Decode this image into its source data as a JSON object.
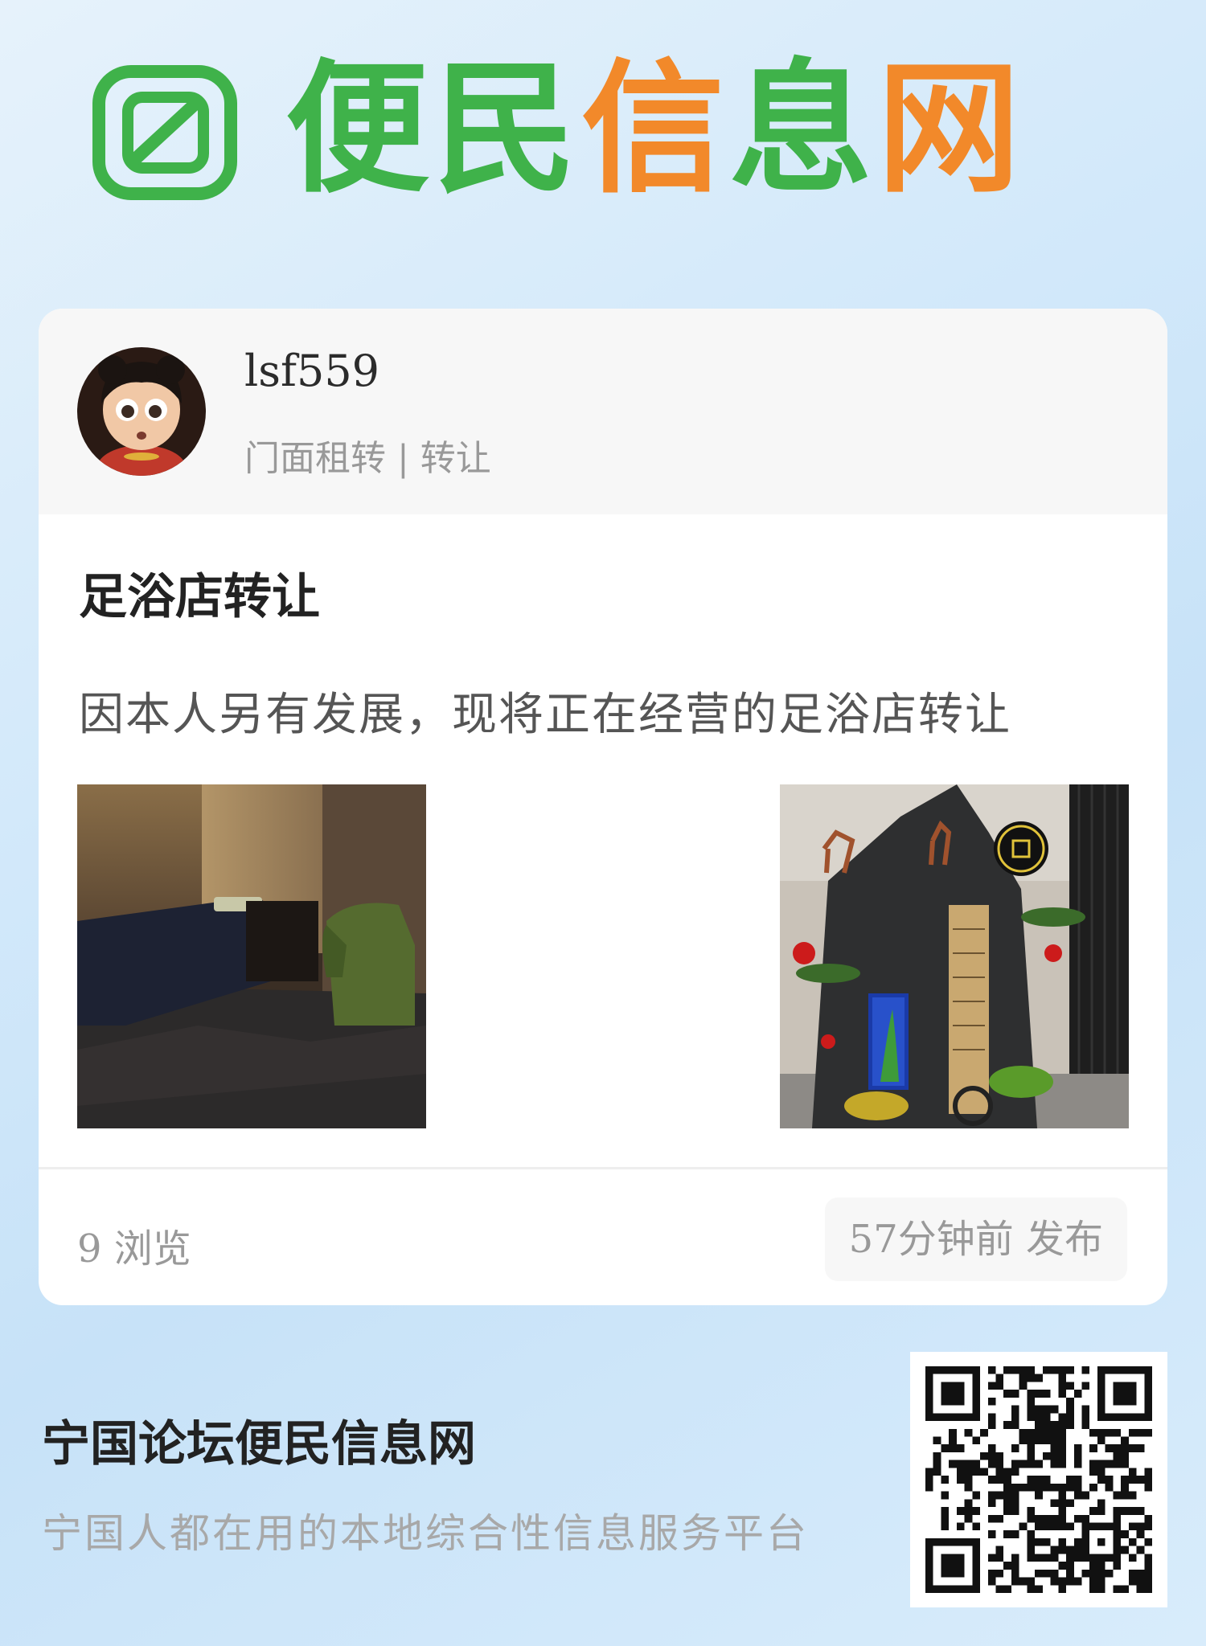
{
  "brand": {
    "logo_text_green_1": "便民",
    "logo_text_orange": "信",
    "logo_text_green_2": "息",
    "logo_text_orange_2": "网",
    "colors": {
      "green": "#3fb24a",
      "orange": "#f2892a"
    },
    "logo_icon": "logo-mark-icon"
  },
  "post": {
    "username": "lsf559",
    "category": "门面租转 | 转让",
    "title": "足浴店转让",
    "description": "因本人另有发展，现将正在经营的足浴店转让",
    "images": [
      {
        "name": "foot-massage-room-photo"
      },
      {
        "name": "fountain-decoration-photo"
      }
    ],
    "views": "9 浏览",
    "published": "57分钟前 发布"
  },
  "footer": {
    "site_name": "宁国论坛便民信息网",
    "tagline": "宁国人都在用的本地综合性信息服务平台",
    "qr_icon": "qr-code-icon"
  }
}
